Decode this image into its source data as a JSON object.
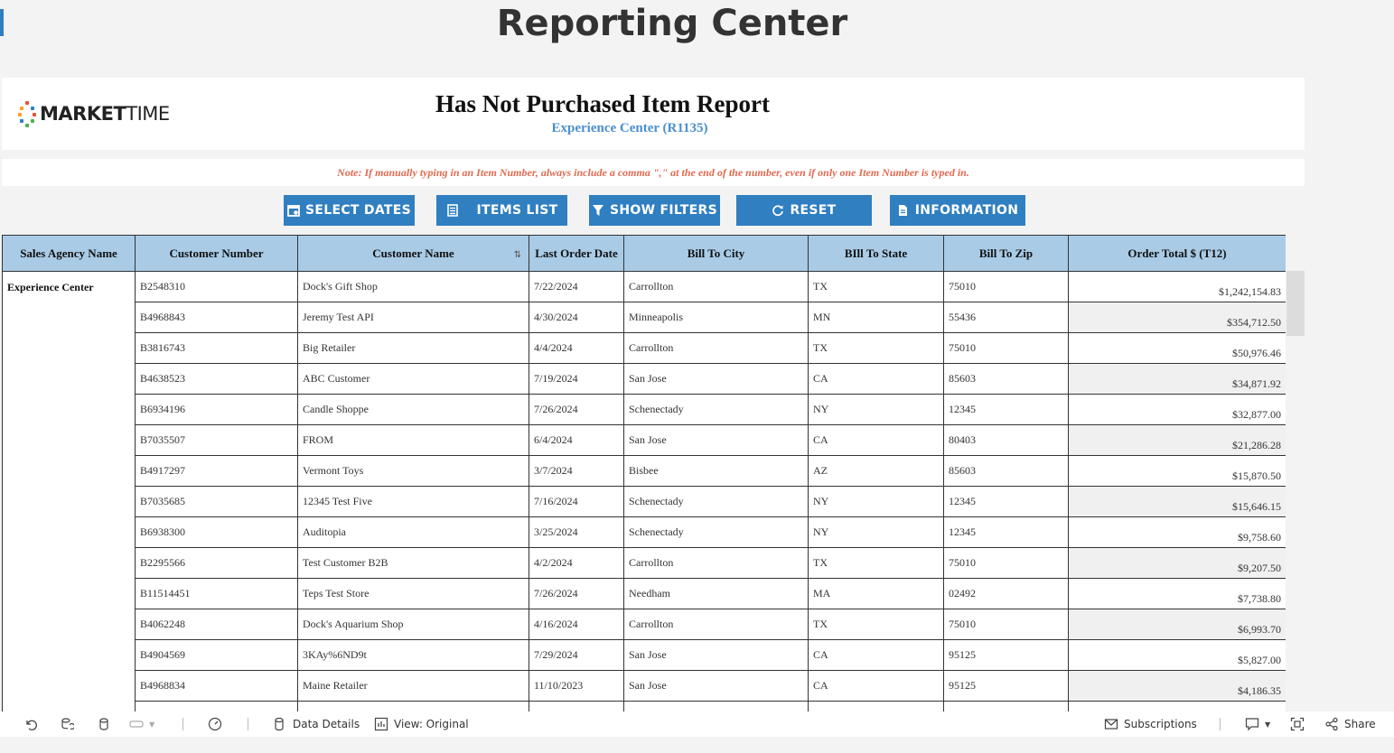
{
  "page": {
    "title": "Reporting Center"
  },
  "logo": {
    "bold": "MARKET",
    "light": "TIME"
  },
  "report": {
    "title": "Has Not Purchased Item Report",
    "subtitle": "Experience Center (R1135)",
    "note": "Note: If manually typing in an Item Number, always include a comma \",\" at the end of the number, even if only one Item Number is typed in."
  },
  "buttons": {
    "select_dates": "SELECT DATES",
    "items_list": "ITEMS LIST",
    "show_filters": "SHOW FILTERS",
    "reset": "RESET",
    "information": "INFORMATION"
  },
  "table": {
    "headers": {
      "agency": "Sales Agency Name",
      "customer_number": "Customer Number",
      "customer_name": "Customer Name",
      "last_order": "Last Order Date",
      "city": "Bill To City",
      "state": "BIll To State",
      "zip": "Bill To Zip",
      "total": "Order Total $ (T12)"
    },
    "agency": "Experience Center",
    "rows": [
      {
        "num": "B2548310",
        "name": "Dock's Gift Shop",
        "date": "7/22/2024",
        "city": "Carrollton",
        "state": "TX",
        "zip": "75010",
        "total": "$1,242,154.83"
      },
      {
        "num": "B4968843",
        "name": "Jeremy Test API",
        "date": "4/30/2024",
        "city": "Minneapolis",
        "state": "MN",
        "zip": "55436",
        "total": "$354,712.50"
      },
      {
        "num": "B3816743",
        "name": "Big Retailer",
        "date": "4/4/2024",
        "city": "Carrollton",
        "state": "TX",
        "zip": "75010",
        "total": "$50,976.46"
      },
      {
        "num": "B4638523",
        "name": "ABC Customer",
        "date": "7/19/2024",
        "city": "San Jose",
        "state": "CA",
        "zip": "85603",
        "total": "$34,871.92"
      },
      {
        "num": "B6934196",
        "name": "Candle Shoppe",
        "date": "7/26/2024",
        "city": "Schenectady",
        "state": "NY",
        "zip": "12345",
        "total": "$32,877.00"
      },
      {
        "num": "B7035507",
        "name": "FROM",
        "date": "6/4/2024",
        "city": "San Jose",
        "state": "CA",
        "zip": "80403",
        "total": "$21,286.28"
      },
      {
        "num": "B4917297",
        "name": "Vermont Toys",
        "date": "3/7/2024",
        "city": "Bisbee",
        "state": "AZ",
        "zip": "85603",
        "total": "$15,870.50"
      },
      {
        "num": "B7035685",
        "name": "12345 Test Five",
        "date": "7/16/2024",
        "city": "Schenectady",
        "state": "NY",
        "zip": "12345",
        "total": "$15,646.15"
      },
      {
        "num": "B6938300",
        "name": "Auditopia",
        "date": "3/25/2024",
        "city": "Schenectady",
        "state": "NY",
        "zip": "12345",
        "total": "$9,758.60"
      },
      {
        "num": "B2295566",
        "name": "Test Customer B2B",
        "date": "4/2/2024",
        "city": "Carrollton",
        "state": "TX",
        "zip": "75010",
        "total": "$9,207.50"
      },
      {
        "num": "B11514451",
        "name": "Teps Test Store",
        "date": "7/26/2024",
        "city": "Needham",
        "state": "MA",
        "zip": "02492",
        "total": "$7,738.80"
      },
      {
        "num": "B4062248",
        "name": "Dock's Aquarium Shop",
        "date": "4/16/2024",
        "city": "Carrollton",
        "state": "TX",
        "zip": "75010",
        "total": "$6,993.70"
      },
      {
        "num": "B4904569",
        "name": "3KAy%6ND9t",
        "date": "7/29/2024",
        "city": "San Jose",
        "state": "CA",
        "zip": "95125",
        "total": "$5,827.00"
      },
      {
        "num": "B4968834",
        "name": "Maine Retailer",
        "date": "11/10/2023",
        "city": "San Jose",
        "state": "CA",
        "zip": "95125",
        "total": "$4,186.35"
      },
      {
        "num": "",
        "name": "",
        "date": "",
        "city": "",
        "state": "",
        "zip": "",
        "total": ""
      }
    ]
  },
  "toolbar": {
    "data_details": "Data Details",
    "view": "View: Original",
    "subscriptions": "Subscriptions",
    "share": "Share"
  },
  "colors": {
    "accent": "#2f7fc1",
    "header_bg": "#a9cbe6",
    "note": "#e06a50",
    "subtitle": "#4a8fcf"
  }
}
